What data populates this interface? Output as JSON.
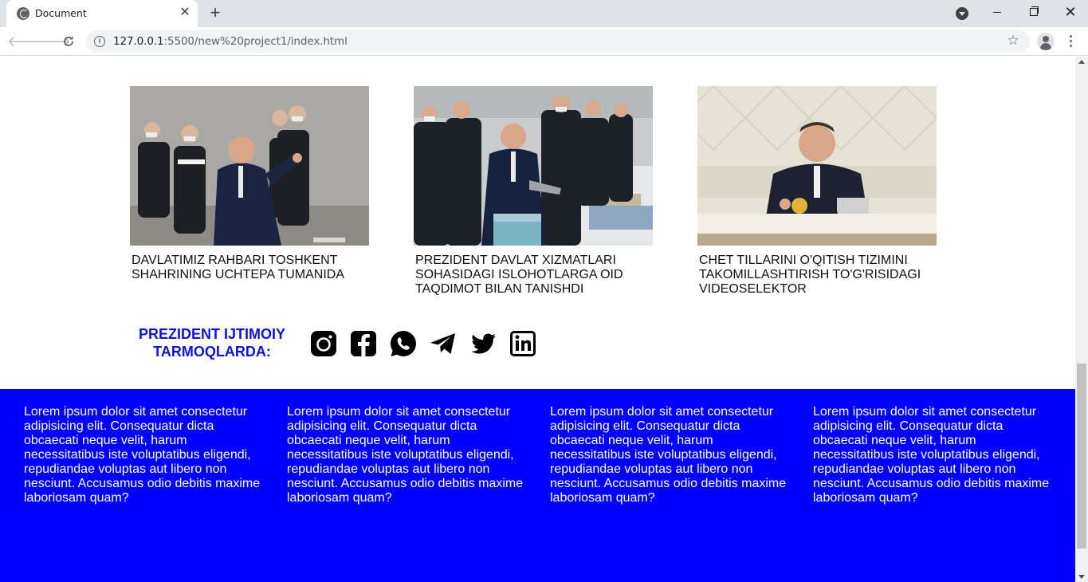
{
  "browser": {
    "tab_title": "Document",
    "tab_close": "✕",
    "new_tab": "+",
    "url_host": "127.0.0.1",
    "url_path": ":5500/new%20project1/index.html"
  },
  "news": [
    {
      "caption": "DAVLATIMIZ RAHBARI TOSHKENT SHAHRINING UCHTEPA TUMANIDA"
    },
    {
      "caption": "PREZIDENT DAVLAT XIZMATLARI SOHASIDAGI ISLOHOTLARGA OID TAQDIMOT BILAN TANISHDI"
    },
    {
      "caption": "CHET TILLARINI O'QITISH TIZIMINI TAKOMILLASHTIRISH TO'G'RISIDAGI VIDEOSELEKTOR"
    }
  ],
  "social": {
    "heading": "PREZIDENT IJTIMOIY TARMOQLARDA:",
    "icons": [
      "instagram-icon",
      "facebook-icon",
      "whatsapp-icon",
      "telegram-icon",
      "twitter-icon",
      "linkedin-icon"
    ]
  },
  "footer": {
    "columns": [
      {
        "text": "Lorem ipsum dolor sit amet consectetur adipisicing elit. Consequatur dicta obcaecati neque velit, harum necessitatibus iste voluptatibus eligendi, repudiandae voluptas aut libero non nesciunt. Accusamus odio debitis maxime laboriosam quam?"
      },
      {
        "text": "Lorem ipsum dolor sit amet consectetur adipisicing elit. Consequatur dicta obcaecati neque velit, harum necessitatibus iste voluptatibus eligendi, repudiandae voluptas aut libero non nesciunt. Accusamus odio debitis maxime laboriosam quam?"
      },
      {
        "text": "Lorem ipsum dolor sit amet consectetur adipisicing elit. Consequatur dicta obcaecati neque velit, harum necessitatibus iste voluptatibus eligendi, repudiandae voluptas aut libero non nesciunt. Accusamus odio debitis maxime laboriosam quam?"
      },
      {
        "text": "Lorem ipsum dolor sit amet consectetur adipisicing elit. Consequatur dicta obcaecati neque velit, harum necessitatibus iste voluptatibus eligendi, repudiandae voluptas aut libero non nesciunt. Accusamus odio debitis maxime laboriosam quam?"
      }
    ]
  },
  "colors": {
    "footer_bg": "#0000ff",
    "heading": "#1010dd"
  }
}
